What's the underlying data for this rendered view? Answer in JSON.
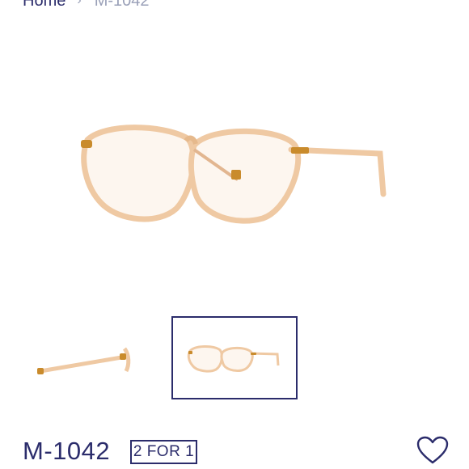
{
  "breadcrumb": {
    "home_label": "Home",
    "separator": "›",
    "current_label": "M-1042"
  },
  "product": {
    "title": "M-1042",
    "promo_badge": "2 FOR 1"
  },
  "gallery": {
    "thumbnail_count": 2,
    "selected_thumbnail": 2
  },
  "icons": {
    "wishlist": "heart-outline-icon"
  },
  "colors": {
    "brand": "#2b2c6b",
    "muted": "#9aa0b8",
    "frame": "#efc9a3",
    "frame_edge": "#d9a77a",
    "hinge": "#c98b2c"
  }
}
